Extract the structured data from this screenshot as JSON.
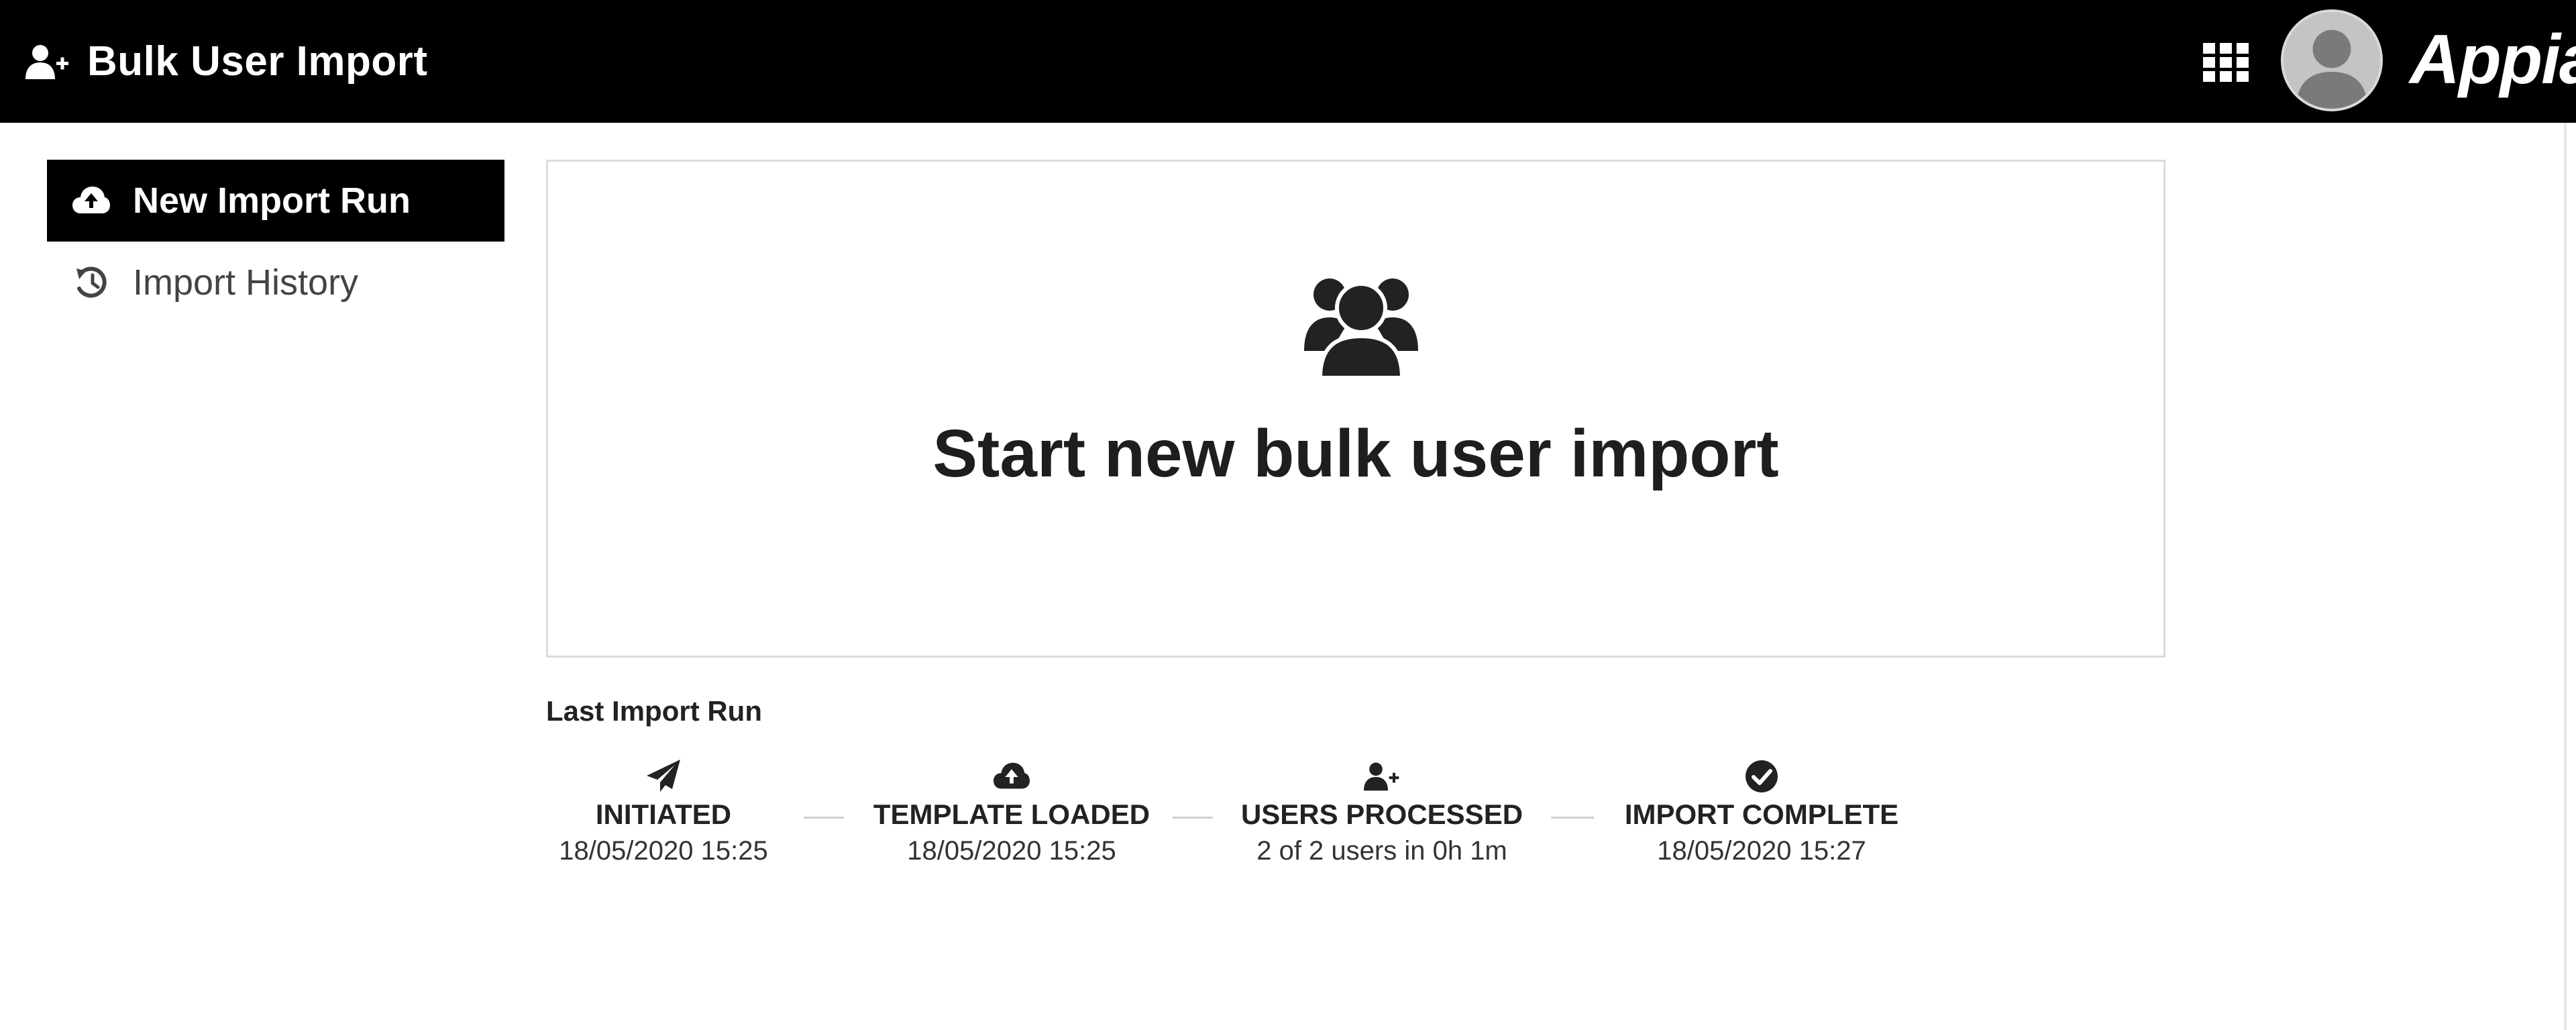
{
  "header": {
    "title": "Bulk User Import",
    "brand": "Appian",
    "icons": {
      "title_icon": "user-plus-icon",
      "apps": "grid-icon",
      "avatar": "user-avatar-icon"
    }
  },
  "sidebar": {
    "items": [
      {
        "label": "New Import Run",
        "icon": "cloud-upload-icon",
        "active": true
      },
      {
        "label": "Import History",
        "icon": "history-icon",
        "active": false
      }
    ]
  },
  "card": {
    "title": "Start new bulk user import",
    "icon": "users-icon"
  },
  "last_import": {
    "title": "Last Import Run",
    "steps": [
      {
        "label": "INITIATED",
        "value": "18/05/2020 15:25",
        "icon": "paper-plane-icon"
      },
      {
        "label": "TEMPLATE LOADED",
        "value": "18/05/2020 15:25",
        "icon": "cloud-upload-icon"
      },
      {
        "label": "USERS PROCESSED",
        "value": "2 of 2 users in 0h 1m",
        "icon": "user-plus-icon"
      },
      {
        "label": "IMPORT COMPLETE",
        "value": "18/05/2020 15:27",
        "icon": "check-circle-icon"
      }
    ]
  },
  "colors": {
    "header_bg": "#000000",
    "active_nav_bg": "#000000",
    "text": "#222222",
    "card_border": "#dcdcdc",
    "connector": "#d0d0d0"
  }
}
